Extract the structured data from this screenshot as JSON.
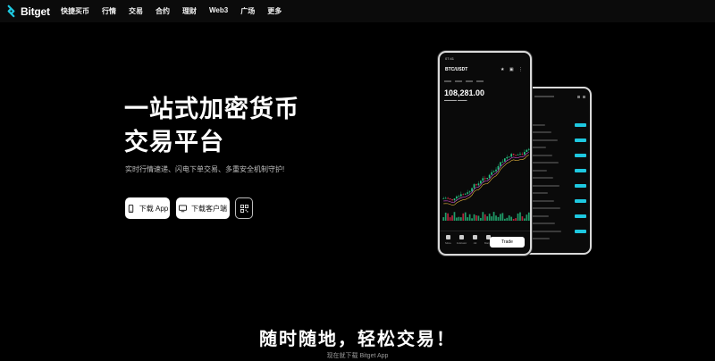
{
  "nav": {
    "logo_text": "Bitget",
    "items": [
      "快捷买币",
      "行情",
      "交易",
      "合约",
      "理财",
      "Web3",
      "广场",
      "更多"
    ]
  },
  "hero": {
    "title_line1": "一站式加密货币",
    "title_line2": "交易平台",
    "subtitle": "实时行情速递、闪电下单交易、多重安全机制守护!",
    "btn_app": "下载 App",
    "btn_pc": "下载客户端"
  },
  "phone": {
    "status": "07:41",
    "pair": "BTC/USDT",
    "price": "108,281.00",
    "trade_label": "Trade",
    "nav_labels": [
      "More",
      "Indicator",
      "Alt",
      "Margin"
    ]
  },
  "section": {
    "title": "随时随地，轻松交易！",
    "subtitle": "现在就下载 Bitget App"
  },
  "colors": {
    "accent": "#1ec8e0",
    "candle_up": "#26c281",
    "candle_down": "#e0294a"
  }
}
